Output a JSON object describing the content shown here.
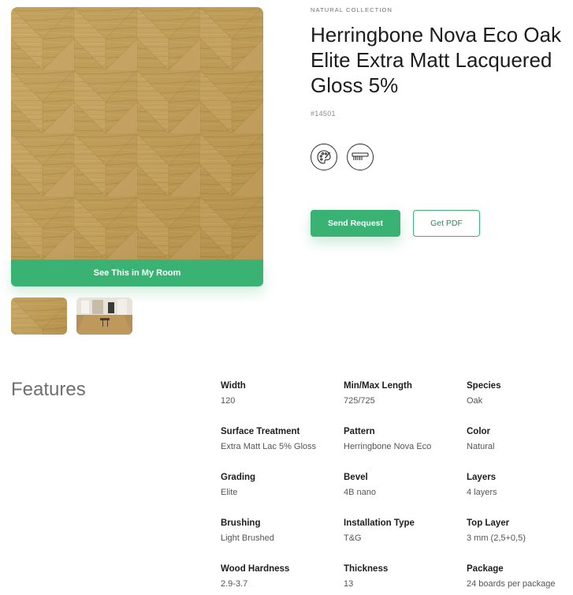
{
  "product": {
    "collection": "NATURAL COLLECTION",
    "title": "Herringbone Nova Eco Oak Elite Extra Matt Lacquered Gloss 5%",
    "sku": "#14501",
    "icons": [
      "palette-icon",
      "comb-icon"
    ]
  },
  "gallery": {
    "room_button_label": "See This in My Room",
    "thumbnails": [
      "herringbone-oak-swatch",
      "room-interior-photo"
    ]
  },
  "actions": {
    "send_request_label": "Send Request",
    "get_pdf_label": "Get PDF"
  },
  "features": {
    "heading": "Features",
    "items": [
      {
        "label": "Width",
        "value": "120"
      },
      {
        "label": "Min/Max Length",
        "value": "725/725"
      },
      {
        "label": "Species",
        "value": "Oak"
      },
      {
        "label": "Surface Treatment",
        "value": "Extra Matt Lac 5% Gloss"
      },
      {
        "label": "Pattern",
        "value": "Herringbone Nova Eco"
      },
      {
        "label": "Color",
        "value": "Natural"
      },
      {
        "label": "Grading",
        "value": "Elite"
      },
      {
        "label": "Bevel",
        "value": "4B nano"
      },
      {
        "label": "Layers",
        "value": "4 layers"
      },
      {
        "label": "Brushing",
        "value": "Light Brushed"
      },
      {
        "label": "Installation Type",
        "value": "T&G"
      },
      {
        "label": "Top Layer",
        "value": "3 mm (2,5+0,5)"
      },
      {
        "label": "Wood Hardness",
        "value": "2.9-3.7"
      },
      {
        "label": "Thickness",
        "value": "13"
      },
      {
        "label": "Package",
        "value": "24 boards per package"
      }
    ]
  },
  "colors": {
    "accent": "#3ab273",
    "wood_light": "#c9a45e",
    "wood_dark": "#a77d3a"
  }
}
